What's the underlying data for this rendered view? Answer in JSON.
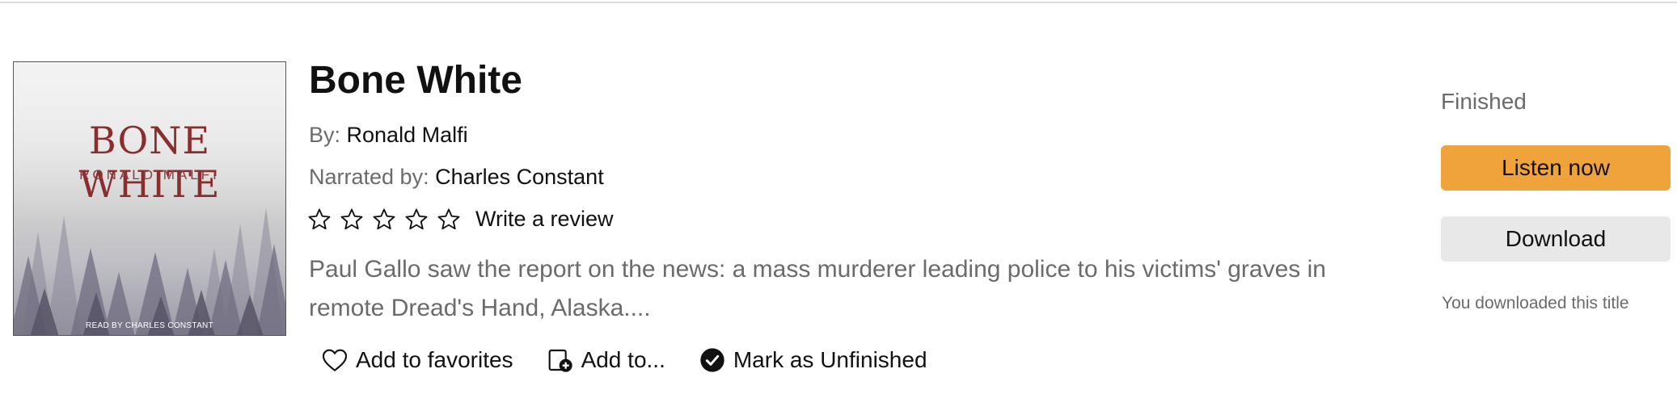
{
  "book": {
    "title": "Bone White",
    "by_label": "By:",
    "author": "Ronald Malfi",
    "narrated_label": "Narrated by:",
    "narrator": "Charles Constant",
    "rating_stars": 0,
    "rating_max": 5,
    "write_review_label": "Write a review",
    "summary": "Paul Gallo saw the report on the news: a mass murderer leading police to his victims' graves in remote Dread's Hand, Alaska....",
    "cover": {
      "title": "BONE WHITE",
      "author": "RONALD MALFI",
      "reader": "READ BY CHARLES CONSTANT"
    }
  },
  "actions": {
    "favorites_label": "Add to favorites",
    "add_to_label": "Add to...",
    "mark_label": "Mark as Unfinished"
  },
  "sidebar": {
    "status": "Finished",
    "listen_label": "Listen now",
    "download_label": "Download",
    "downloaded_note": "You downloaded this title"
  },
  "colors": {
    "accent": "#f0a33a",
    "secondary_button": "#e8e8e8",
    "muted_text": "#6b6b6b"
  },
  "icons": [
    "star-outline-icon",
    "heart-outline-icon",
    "add-to-collection-icon",
    "check-circle-icon"
  ]
}
